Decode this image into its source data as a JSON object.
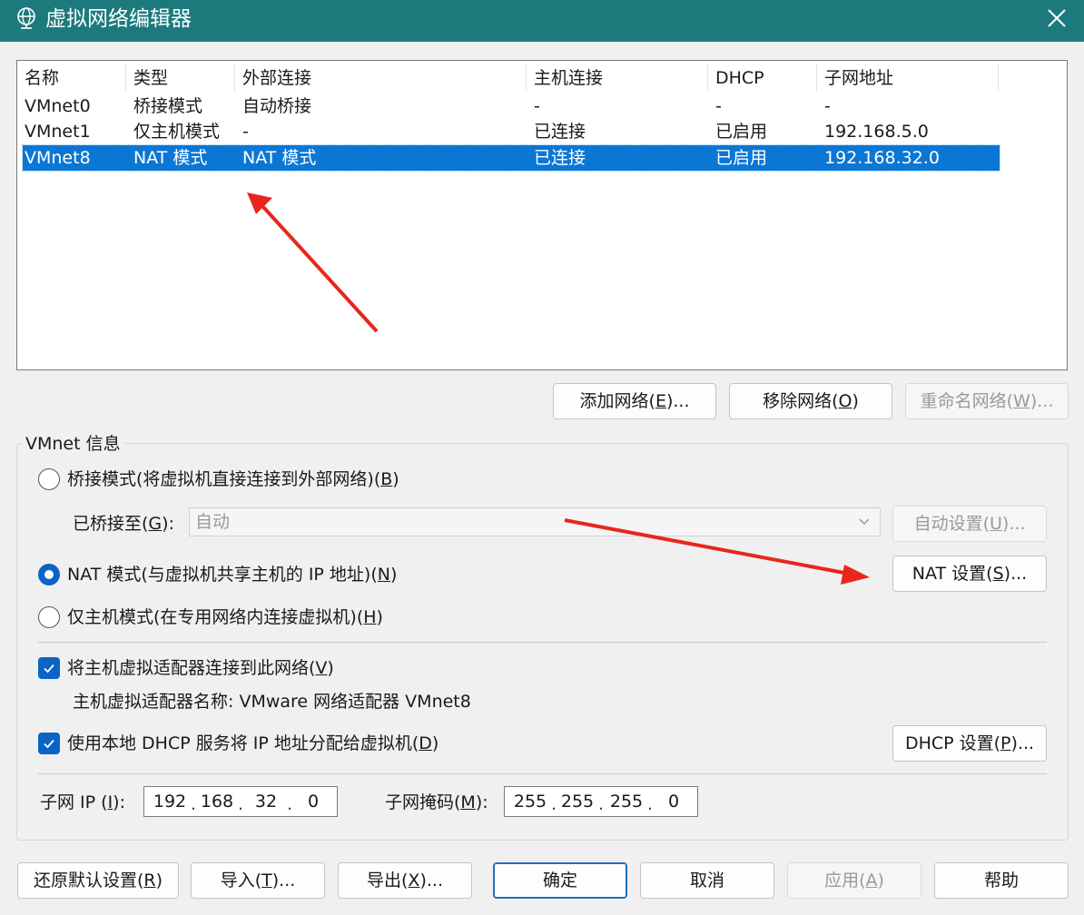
{
  "window": {
    "title": "虚拟网络编辑器",
    "icon": "globe-icon"
  },
  "network_table": {
    "columns": [
      "名称",
      "类型",
      "外部连接",
      "主机连接",
      "DHCP",
      "子网地址"
    ],
    "rows": [
      {
        "name": "VMnet0",
        "type": "桥接模式",
        "external": "自动桥接",
        "host": "-",
        "dhcp": "-",
        "subnet": "-"
      },
      {
        "name": "VMnet1",
        "type": "仅主机模式",
        "external": "-",
        "host": "已连接",
        "dhcp": "已启用",
        "subnet": "192.168.5.0"
      },
      {
        "name": "VMnet8",
        "type": "NAT 模式",
        "external": "NAT 模式",
        "host": "已连接",
        "dhcp": "已启用",
        "subnet": "192.168.32.0"
      }
    ],
    "selected_row": 2
  },
  "list_buttons": {
    "add": {
      "text": "添加网络(",
      "key": "E",
      "tail": ")..."
    },
    "remove": {
      "text": "移除网络(",
      "key": "O",
      "tail": ")"
    },
    "rename": {
      "text": "重命名网络(",
      "key": "W",
      "tail": ")..."
    }
  },
  "vmnet_info": {
    "title": "VMnet 信息",
    "bridged": {
      "text": "桥接模式(将虚拟机直接连接到外部网络)(",
      "key": "B",
      "tail": ")"
    },
    "bridged_to": {
      "text": "已桥接至(",
      "key": "G",
      "tail": "):",
      "value": "自动"
    },
    "auto_settings": {
      "text": "自动设置(",
      "key": "U",
      "tail": ")..."
    },
    "nat": {
      "text": "NAT 模式(与虚拟机共享主机的 IP 地址)(",
      "key": "N",
      "tail": ")"
    },
    "nat_settings": {
      "text": "NAT 设置(",
      "key": "S",
      "tail": ")..."
    },
    "host_only": {
      "text": "仅主机模式(在专用网络内连接虚拟机)(",
      "key": "H",
      "tail": ")"
    },
    "connect_adapter": {
      "text": "将主机虚拟适配器连接到此网络(",
      "key": "V",
      "tail": ")"
    },
    "adapter_name": "主机虚拟适配器名称: VMware 网络适配器 VMnet8",
    "use_dhcp": {
      "text": "使用本地 DHCP 服务将 IP 地址分配给虚拟机(",
      "key": "D",
      "tail": ")"
    },
    "dhcp_settings": {
      "text": "DHCP 设置(",
      "key": "P",
      "tail": ")..."
    },
    "subnet_ip": {
      "text": "子网 IP (",
      "key": "I",
      "tail": "):",
      "octets": [
        "192",
        "168",
        "32",
        "0"
      ]
    },
    "subnet_mask": {
      "text": "子网掩码(",
      "key": "M",
      "tail": "):",
      "octets": [
        "255",
        "255",
        "255",
        "0"
      ]
    }
  },
  "footer_buttons": {
    "restore": {
      "text": "还原默认设置(",
      "key": "R",
      "tail": ")"
    },
    "import": {
      "text": "导入(",
      "key": "T",
      "tail": ")..."
    },
    "export": {
      "text": "导出(",
      "key": "X",
      "tail": ")..."
    },
    "ok": "确定",
    "cancel": "取消",
    "apply": {
      "text": "应用(",
      "key": "A",
      "tail": ")"
    },
    "help": "帮助"
  },
  "colors": {
    "titlebar": "#1c7a7d",
    "selection": "#0b77d5",
    "accent": "#0b63c4",
    "arrow": "#e8261c"
  }
}
